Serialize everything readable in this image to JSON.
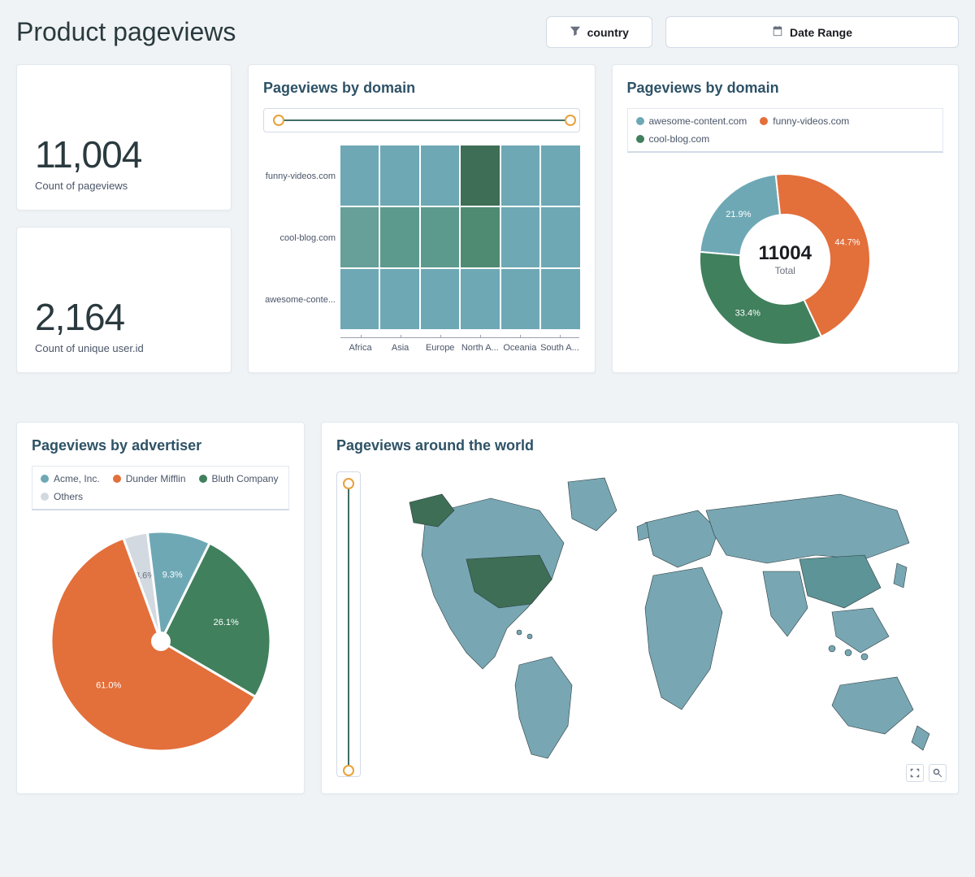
{
  "header": {
    "title": "Product pageviews",
    "country_filter_label": "country",
    "date_range_label": "Date Range"
  },
  "metrics": {
    "pageviews_value": "11,004",
    "pageviews_label": "Count of pageviews",
    "unique_users_value": "2,164",
    "unique_users_label": "Count of unique user.id"
  },
  "panels": {
    "heatmap_title": "Pageviews by domain",
    "donut_title": "Pageviews by domain",
    "pie_title": "Pageviews by advertiser",
    "map_title": "Pageviews around the world"
  },
  "colors": {
    "teal": "#6ea8b5",
    "teal_mid": "#5d9a8e",
    "green": "#40805d",
    "dark_green": "#3e6e55",
    "orange": "#e36f3b",
    "grey": "#d3d9e0"
  },
  "donut": {
    "center_value": "11004",
    "center_label": "Total",
    "legend": [
      {
        "label": "awesome-content.com",
        "color": "#6ea8b5"
      },
      {
        "label": "funny-videos.com",
        "color": "#e36f3b"
      },
      {
        "label": "cool-blog.com",
        "color": "#40805d"
      }
    ]
  },
  "pie": {
    "legend": [
      {
        "label": "Acme, Inc.",
        "color": "#6ea8b5"
      },
      {
        "label": "Dunder Mifflin",
        "color": "#e36f3b"
      },
      {
        "label": "Bluth Company",
        "color": "#40805d"
      },
      {
        "label": "Others",
        "color": "#d3d9e0"
      }
    ]
  },
  "chart_data": [
    {
      "type": "heatmap",
      "title": "Pageviews by domain",
      "y_categories": [
        "funny-videos.com",
        "cool-blog.com",
        "awesome-conte..."
      ],
      "x_categories": [
        "Africa",
        "Asia",
        "Europe",
        "North A...",
        "Oceania",
        "South A..."
      ],
      "values": [
        [
          0.5,
          0.5,
          0.5,
          1.0,
          0.5,
          0.5
        ],
        [
          0.6,
          0.7,
          0.7,
          0.8,
          0.5,
          0.5
        ],
        [
          0.5,
          0.5,
          0.5,
          0.5,
          0.5,
          0.5
        ]
      ],
      "note": "values are relative intensity 0-1 estimated from cell shade"
    },
    {
      "type": "pie",
      "title": "Pageviews by domain",
      "subtype": "donut",
      "total": 11004,
      "series": [
        {
          "name": "awesome-content.com",
          "value_pct": 21.9,
          "color": "#6ea8b5"
        },
        {
          "name": "funny-videos.com",
          "value_pct": 44.7,
          "color": "#e36f3b"
        },
        {
          "name": "cool-blog.com",
          "value_pct": 33.4,
          "color": "#40805d"
        }
      ]
    },
    {
      "type": "pie",
      "title": "Pageviews by advertiser",
      "series": [
        {
          "name": "Acme, Inc.",
          "value_pct": 9.3,
          "color": "#6ea8b5"
        },
        {
          "name": "Dunder Mifflin",
          "value_pct": 61.0,
          "color": "#e36f3b"
        },
        {
          "name": "Bluth Company",
          "value_pct": 26.1,
          "color": "#40805d"
        },
        {
          "name": "Others",
          "value_pct": 3.6,
          "color": "#d3d9e0"
        }
      ]
    },
    {
      "type": "map",
      "title": "Pageviews around the world",
      "note": "Choropleth world map; most countries light teal, USA and Alaska highlighted dark green; China slightly darker teal",
      "highlighted": [
        "United States"
      ],
      "base_color": "#78a7b3",
      "highlight_color": "#3e6e55"
    }
  ]
}
